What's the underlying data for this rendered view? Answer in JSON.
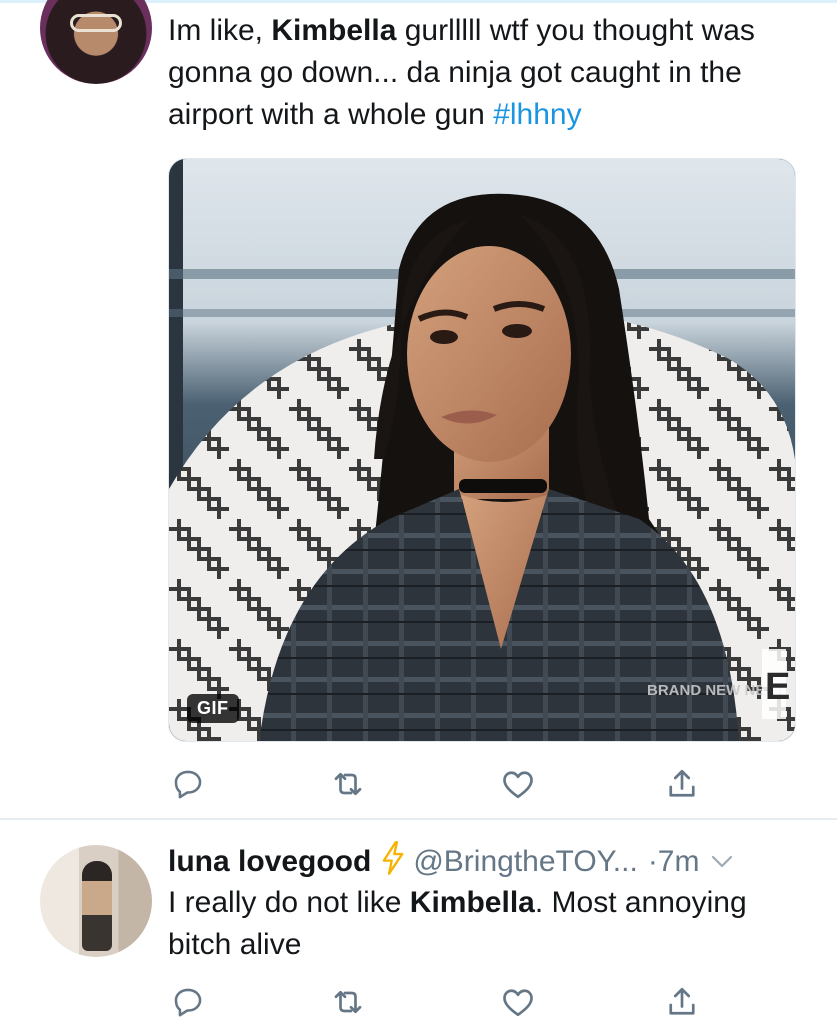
{
  "tweet_1": {
    "text": {
      "before": "Im like, ",
      "bold": "Kimbella",
      "after": " gurlllll wtf you thought was gonna go down... da ninja got caught in the airport with a whole gun ",
      "hashtag": "#lhhny"
    },
    "media": {
      "badge": "GIF",
      "watermark": "BRAND NEW NEXT",
      "network_logo": "E"
    }
  },
  "tweet_2": {
    "display_name": "luna lovegood",
    "emoji": "⚡",
    "handle": "@BringtheTOY...",
    "time": "·7m",
    "text": {
      "before": "I really do not like ",
      "bold": "Kimbella",
      "after": ". Most annoying bitch alive"
    }
  },
  "icons": {
    "reply": "reply-icon",
    "retweet": "retweet-icon",
    "like": "heart-icon",
    "share": "share-icon",
    "more": "chevron-down-icon",
    "icon_color": "#657786",
    "link_color": "#1b95e0"
  }
}
